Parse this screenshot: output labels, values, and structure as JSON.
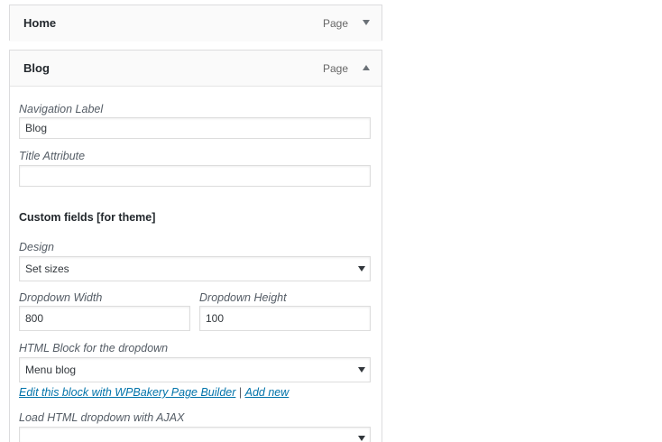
{
  "menu_items": {
    "home": {
      "title": "Home",
      "type": "Page",
      "toggle_icon": "triangle-down-icon"
    },
    "blog": {
      "title": "Blog",
      "type": "Page",
      "toggle_icon": "triangle-up-icon",
      "navigation_label": {
        "label": "Navigation Label",
        "value": "Blog"
      },
      "title_attribute": {
        "label": "Title Attribute",
        "value": ""
      },
      "custom_fields_heading": "Custom fields [for theme]",
      "design": {
        "label": "Design",
        "selected": "Set sizes"
      },
      "dropdown_width": {
        "label": "Dropdown Width",
        "value": "800"
      },
      "dropdown_height": {
        "label": "Dropdown Height",
        "value": "100"
      },
      "html_block": {
        "label": "HTML Block for the dropdown",
        "selected": "Menu blog"
      },
      "links": {
        "edit_block": "Edit this block with WPBakery Page Builder",
        "separator": "|",
        "add_new": "Add new"
      },
      "ajax_dropdown": {
        "label": "Load HTML dropdown with AJAX",
        "selected": ""
      }
    }
  },
  "colors": {
    "link": "#0073aa",
    "border": "#dcdcde",
    "bar_background": "#fafafa",
    "icon": "#555d66"
  }
}
